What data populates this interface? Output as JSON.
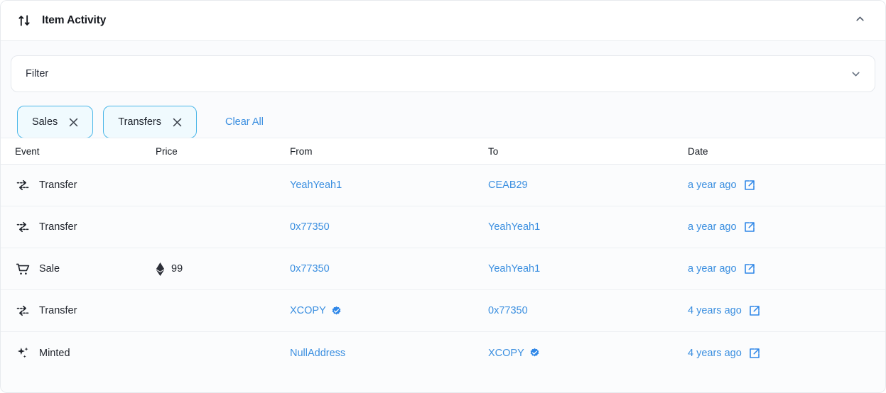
{
  "header": {
    "title": "Item Activity",
    "activity_icon": "arrows-up-down-icon",
    "collapse_icon": "chevron-up-icon"
  },
  "filter": {
    "label": "Filter",
    "chevron_icon": "chevron-down-icon",
    "chips": [
      {
        "label": "Sales",
        "close_icon": "close-icon"
      },
      {
        "label": "Transfers",
        "close_icon": "close-icon"
      }
    ],
    "clear_all_label": "Clear All"
  },
  "table": {
    "columns": [
      "Event",
      "Price",
      "From",
      "To",
      "Date"
    ],
    "rows": [
      {
        "event": "Transfer",
        "event_icon": "transfer-arrows-icon",
        "price": "",
        "price_icon": "",
        "from": "YeahYeah1",
        "from_verified": false,
        "to": "CEAB29",
        "to_verified": false,
        "date": "a year ago",
        "date_icon": "external-link-icon"
      },
      {
        "event": "Transfer",
        "event_icon": "transfer-arrows-icon",
        "price": "",
        "price_icon": "",
        "from": "0x77350",
        "from_verified": false,
        "to": "YeahYeah1",
        "to_verified": false,
        "date": "a year ago",
        "date_icon": "external-link-icon"
      },
      {
        "event": "Sale",
        "event_icon": "shopping-cart-icon",
        "price": "99",
        "price_icon": "ethereum-icon",
        "from": "0x77350",
        "from_verified": false,
        "to": "YeahYeah1",
        "to_verified": false,
        "date": "a year ago",
        "date_icon": "external-link-icon"
      },
      {
        "event": "Transfer",
        "event_icon": "transfer-arrows-icon",
        "price": "",
        "price_icon": "",
        "from": "XCOPY",
        "from_verified": true,
        "to": "0x77350",
        "to_verified": false,
        "date": "4 years ago",
        "date_icon": "external-link-icon"
      },
      {
        "event": "Minted",
        "event_icon": "sparkles-icon",
        "price": "",
        "price_icon": "",
        "from": "NullAddress",
        "from_verified": false,
        "to": "XCOPY",
        "to_verified": true,
        "date": "4 years ago",
        "date_icon": "external-link-icon"
      }
    ]
  },
  "colors": {
    "link_blue": "#3b8fe0",
    "chip_border": "#4cb7e8",
    "chip_fill": "#f0fafe",
    "verified_blue": "#2f87e8",
    "text_dark": "#22262e"
  }
}
